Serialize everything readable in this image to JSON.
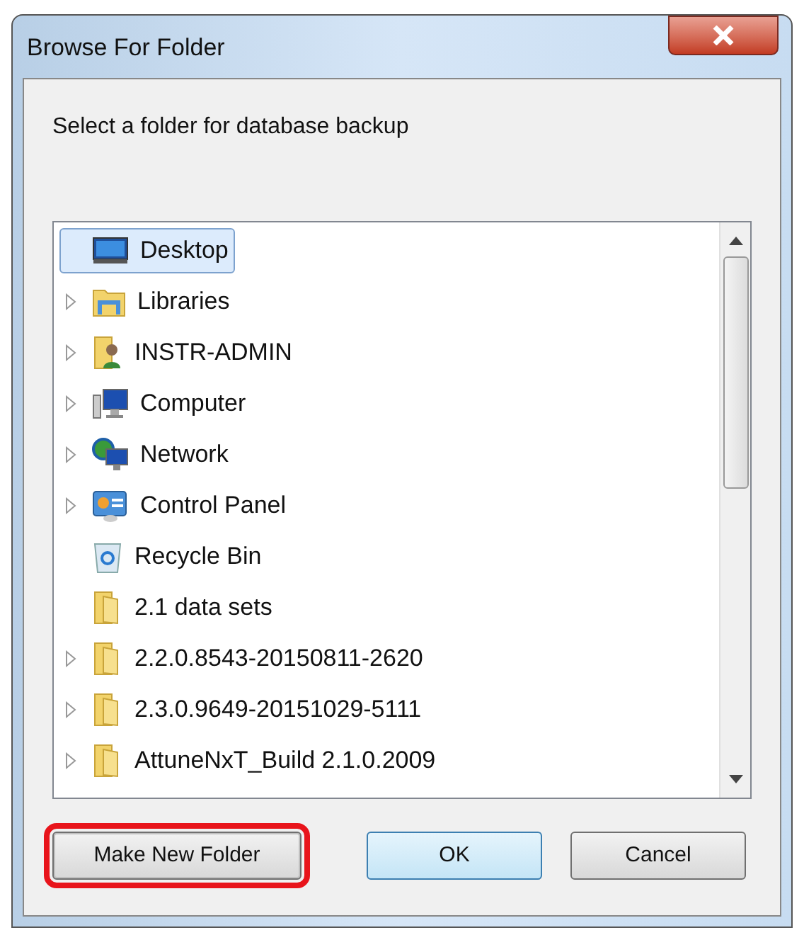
{
  "window": {
    "title": "Browse For Folder"
  },
  "prompt": "Select a folder for database backup",
  "tree": [
    {
      "label": "Desktop",
      "kind": "desktop",
      "selected": true,
      "expandable": false,
      "children": [
        {
          "label": "Libraries",
          "kind": "libraries",
          "selected": false,
          "expandable": true
        },
        {
          "label": "INSTR-ADMIN",
          "kind": "user",
          "selected": false,
          "expandable": true
        },
        {
          "label": "Computer",
          "kind": "computer",
          "selected": false,
          "expandable": true
        },
        {
          "label": "Network",
          "kind": "network",
          "selected": false,
          "expandable": true
        },
        {
          "label": "Control Panel",
          "kind": "control",
          "selected": false,
          "expandable": true
        },
        {
          "label": "Recycle Bin",
          "kind": "recycle",
          "selected": false,
          "expandable": false
        },
        {
          "label": "2.1 data sets",
          "kind": "folder",
          "selected": false,
          "expandable": false
        },
        {
          "label": "2.2.0.8543-20150811-2620",
          "kind": "folder",
          "selected": false,
          "expandable": true
        },
        {
          "label": "2.3.0.9649-20151029-5111",
          "kind": "folder",
          "selected": false,
          "expandable": true
        },
        {
          "label": "AttuneNxT_Build 2.1.0.2009",
          "kind": "folder",
          "selected": false,
          "expandable": true
        }
      ]
    }
  ],
  "buttons": [
    {
      "label": "Make New Folder",
      "default": false,
      "highlighted": true
    },
    {
      "label": "OK",
      "default": true,
      "highlighted": false
    },
    {
      "label": "Cancel",
      "default": false,
      "highlighted": false
    }
  ]
}
